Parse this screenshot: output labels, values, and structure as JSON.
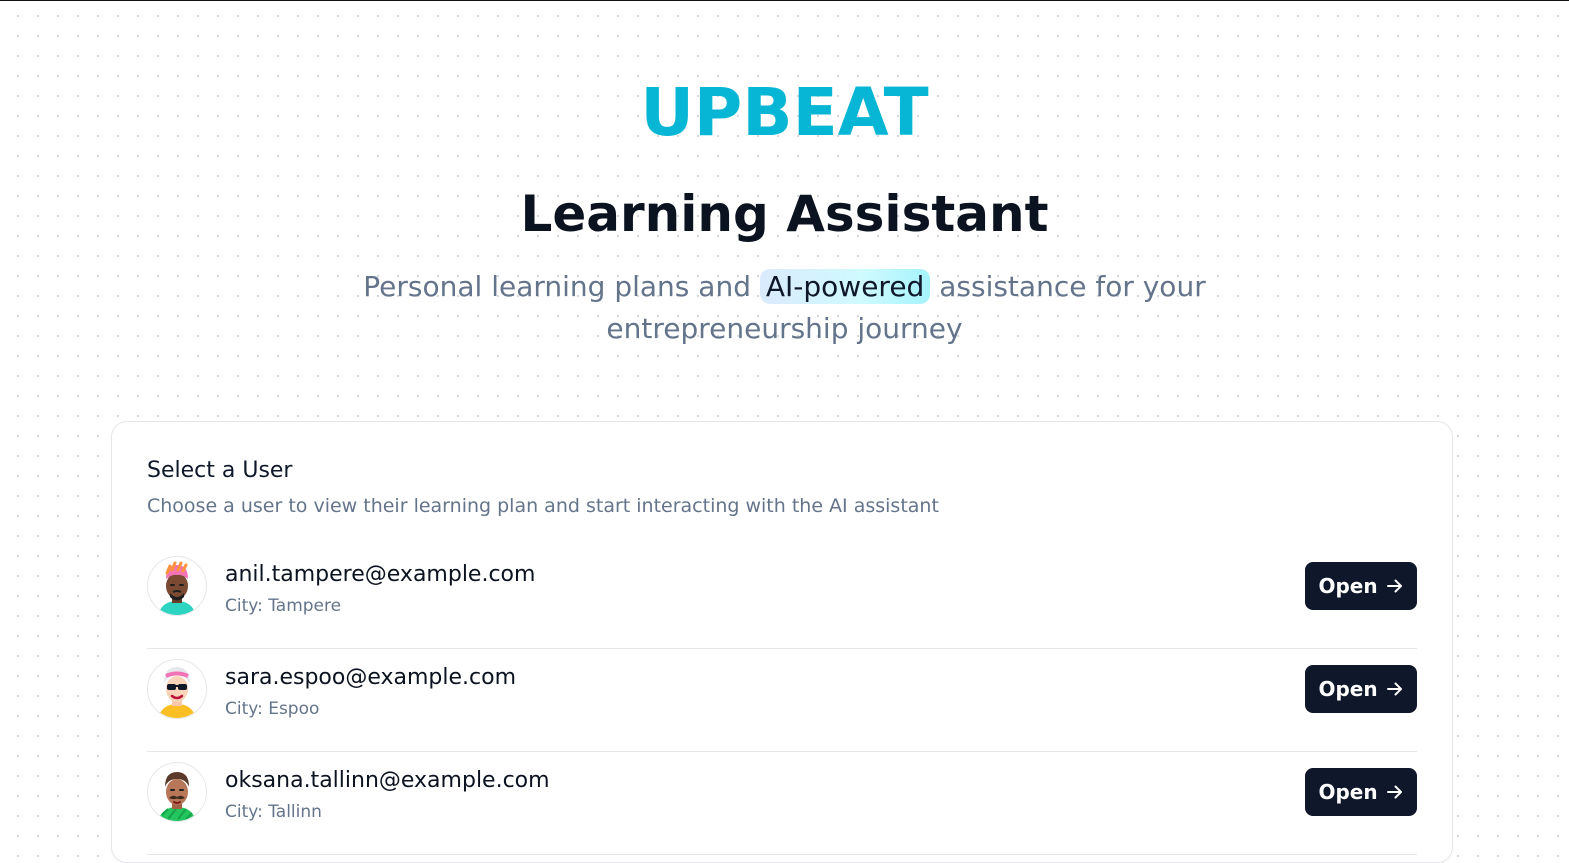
{
  "brand": "UPBEAT",
  "title": "Learning Assistant",
  "subtitle": {
    "before": "Personal learning plans and",
    "highlight": "AI-powered",
    "after": "assistance for your",
    "line2": "entrepreneurship journey"
  },
  "card": {
    "title": "Select a User",
    "description": "Choose a user to view their learning plan and start interacting with the AI assistant"
  },
  "users": [
    {
      "email": "anil.tampere@example.com",
      "city": "City: Tampere",
      "button": "Open",
      "avatar": "avatar-pink-hair-icon"
    },
    {
      "email": "sara.espoo@example.com",
      "city": "City: Espoo",
      "button": "Open",
      "avatar": "avatar-sunglasses-icon"
    },
    {
      "email": "oksana.tallinn@example.com",
      "city": "City: Tallinn",
      "button": "Open",
      "avatar": "avatar-mustache-icon"
    }
  ],
  "colors": {
    "brand": "#06b6d4",
    "button": "#0f172a",
    "muted_text": "#64748b"
  }
}
